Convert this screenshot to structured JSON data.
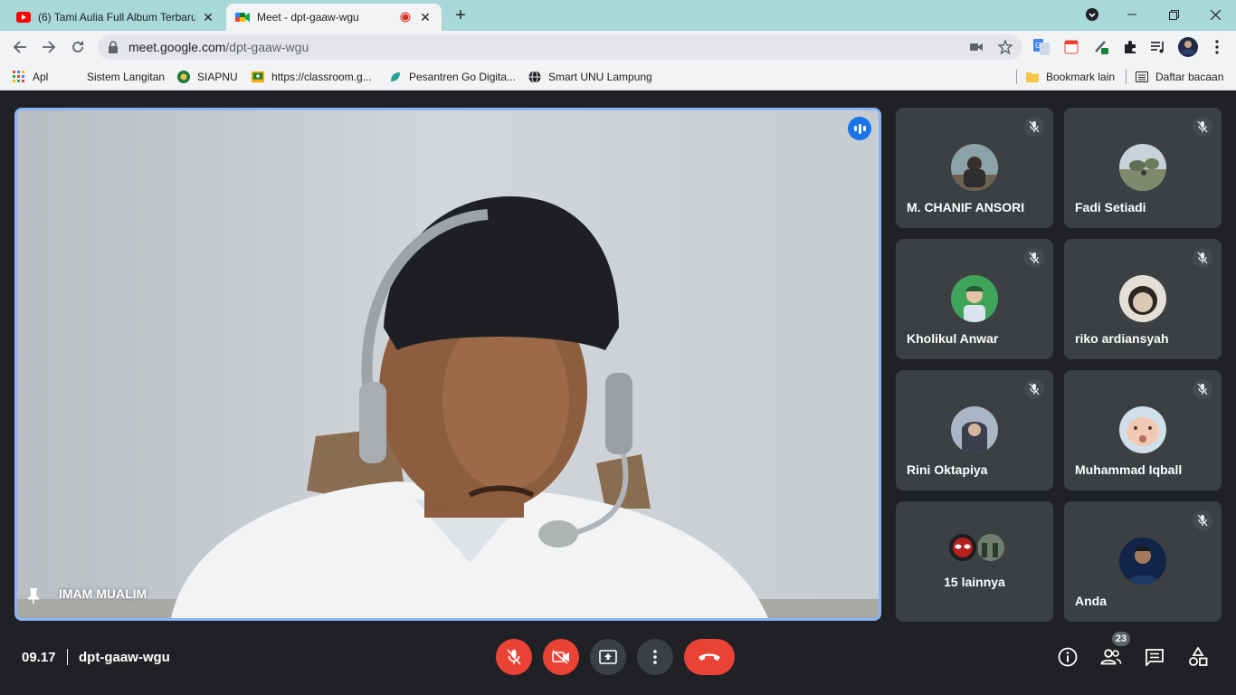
{
  "browser": {
    "tabs": [
      {
        "title": "(6) Tami Aulia Full Album Terbaru",
        "icon": "youtube-icon"
      },
      {
        "title": "Meet - dpt-gaaw-wgu",
        "icon": "meet-icon",
        "recording": true
      }
    ],
    "url_host": "meet.google.com",
    "url_path": "/dpt-gaaw-wgu",
    "bookmarks": [
      {
        "label": "Apl",
        "icon": "apps-grid-icon"
      },
      {
        "label": "Sistem Langitan",
        "icon": ""
      },
      {
        "label": "SIAPNU",
        "icon": "nu-logo-icon"
      },
      {
        "label": "https://classroom.g...",
        "icon": "classroom-icon"
      },
      {
        "label": "Pesantren Go Digita...",
        "icon": "leaf-icon"
      },
      {
        "label": "Smart UNU Lampung",
        "icon": "globe-icon"
      }
    ],
    "bookmarks_right": [
      {
        "label": "Bookmark lain",
        "icon": "folder-icon"
      },
      {
        "label": "Daftar bacaan",
        "icon": "reading-list-icon"
      }
    ]
  },
  "meet": {
    "main_speaker": "IMAM MUALIM",
    "participants": [
      {
        "name": "M. CHANIF ANSORI",
        "muted": true
      },
      {
        "name": "Fadi Setiadi",
        "muted": true
      },
      {
        "name": "Kholikul Anwar",
        "muted": true
      },
      {
        "name": "riko ardiansyah",
        "muted": true
      },
      {
        "name": "Rini Oktapiya",
        "muted": true
      },
      {
        "name": "Muhammad Iqball",
        "muted": true
      },
      {
        "name": "15 lainnya",
        "muted": false
      },
      {
        "name": "Anda",
        "muted": true
      }
    ],
    "time": "09.17",
    "meeting_code": "dpt-gaaw-wgu",
    "participant_count": "23",
    "colors": {
      "accent": "#8ab4f8",
      "speaking": "#1a73e8",
      "danger": "#ea4335",
      "tile": "#3c4043",
      "background": "#202124"
    }
  }
}
